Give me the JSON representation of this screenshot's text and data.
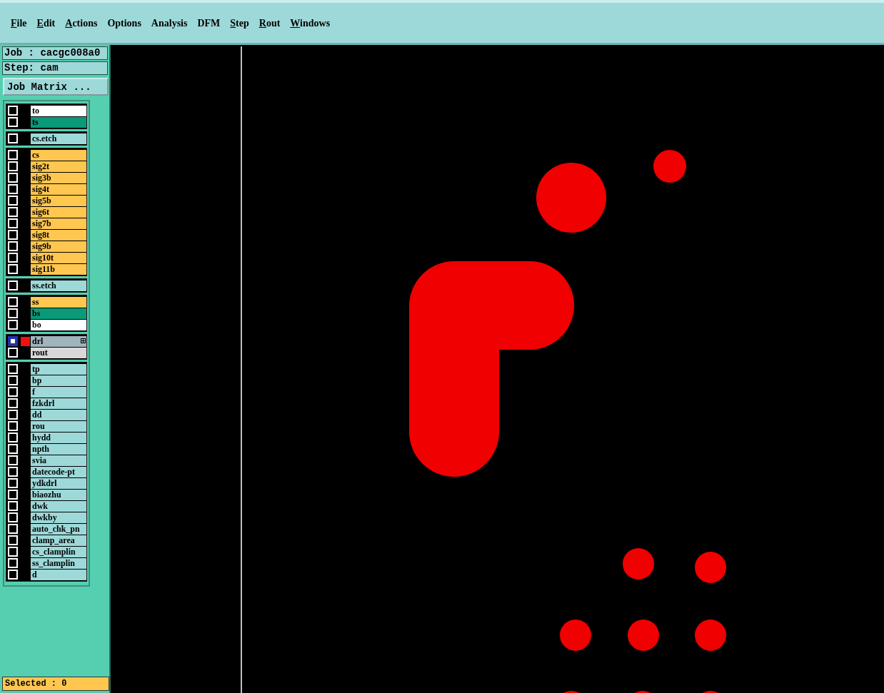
{
  "menu": [
    {
      "label": "File",
      "mnemonic": true
    },
    {
      "label": "Edit",
      "mnemonic": true
    },
    {
      "label": "Actions",
      "mnemonic": true
    },
    {
      "label": "Options",
      "mnemonic": false
    },
    {
      "label": "Analysis",
      "mnemonic": false
    },
    {
      "label": "DFM",
      "mnemonic": false
    },
    {
      "label": "Step",
      "mnemonic": true
    },
    {
      "label": "Rout",
      "mnemonic": true
    },
    {
      "label": "Windows",
      "mnemonic": true
    }
  ],
  "job": {
    "job_label": "Job : cacgc008a0",
    "step_label": "Step: cam",
    "matrix_button": "Job Matrix ..."
  },
  "layer_groups": [
    [
      {
        "name": "to",
        "color": "#ffffff",
        "active": false
      },
      {
        "name": "ts",
        "color": "#0a9a78",
        "active": false
      }
    ],
    [
      {
        "name": "cs.etch",
        "color": "#9ed9d9",
        "active": false
      }
    ],
    [
      {
        "name": "cs",
        "color": "#ffc750",
        "active": false
      },
      {
        "name": "sig2t",
        "color": "#ffc750",
        "active": false
      },
      {
        "name": "sig3b",
        "color": "#ffc750",
        "active": false
      },
      {
        "name": "sig4t",
        "color": "#ffc750",
        "active": false
      },
      {
        "name": "sig5b",
        "color": "#ffc750",
        "active": false
      },
      {
        "name": "sig6t",
        "color": "#ffc750",
        "active": false
      },
      {
        "name": "sig7b",
        "color": "#ffc750",
        "active": false
      },
      {
        "name": "sig8t",
        "color": "#ffc750",
        "active": false
      },
      {
        "name": "sig9b",
        "color": "#ffc750",
        "active": false
      },
      {
        "name": "sig10t",
        "color": "#ffc750",
        "active": false
      },
      {
        "name": "sig11b",
        "color": "#ffc750",
        "active": false
      }
    ],
    [
      {
        "name": "ss.etch",
        "color": "#9ed9d9",
        "active": false
      }
    ],
    [
      {
        "name": "ss",
        "color": "#ffc750",
        "active": false
      },
      {
        "name": "bs",
        "color": "#0a9a78",
        "active": false
      },
      {
        "name": "bo",
        "color": "#ffffff",
        "active": false
      }
    ],
    [
      {
        "name": "drl",
        "color": "#9fb4bc",
        "active": true
      },
      {
        "name": "rout",
        "color": "#d8d8d8",
        "active": false
      }
    ],
    [
      {
        "name": "tp",
        "color": "#9ed9d9",
        "active": false
      },
      {
        "name": "bp",
        "color": "#9ed9d9",
        "active": false
      },
      {
        "name": "f",
        "color": "#9ed9d9",
        "active": false
      },
      {
        "name": "fzkdrl",
        "color": "#9ed9d9",
        "active": false
      },
      {
        "name": "dd",
        "color": "#9ed9d9",
        "active": false
      },
      {
        "name": "rou",
        "color": "#9ed9d9",
        "active": false
      },
      {
        "name": "hydd",
        "color": "#9ed9d9",
        "active": false
      },
      {
        "name": "npth",
        "color": "#9ed9d9",
        "active": false
      },
      {
        "name": "svia",
        "color": "#9ed9d9",
        "active": false
      },
      {
        "name": "datecode-pt",
        "color": "#9ed9d9",
        "active": false
      },
      {
        "name": "ydkdrl",
        "color": "#9ed9d9",
        "active": false
      },
      {
        "name": "biaozhu",
        "color": "#9ed9d9",
        "active": false
      },
      {
        "name": "dwk",
        "color": "#9ed9d9",
        "active": false
      },
      {
        "name": "dwkby",
        "color": "#9ed9d9",
        "active": false
      },
      {
        "name": "auto_chk_pn",
        "color": "#9ed9d9",
        "active": false
      },
      {
        "name": "clamp_area",
        "color": "#9ed9d9",
        "active": false
      },
      {
        "name": "cs_clamplin",
        "color": "#9ed9d9",
        "active": false
      },
      {
        "name": "ss_clamplin",
        "color": "#9ed9d9",
        "active": false
      },
      {
        "name": "d",
        "color": "#9ed9d9",
        "active": false
      }
    ]
  ],
  "status": "Selected : 0"
}
